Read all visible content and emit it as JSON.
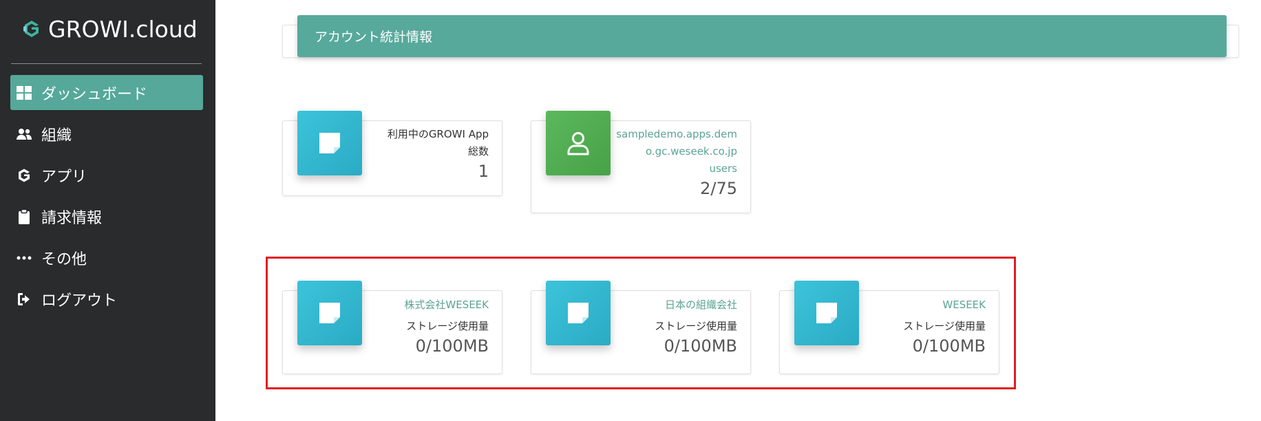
{
  "brand": {
    "name": "GROWI.cloud",
    "logo_icon": "growi-logo-icon"
  },
  "sidebar": {
    "items": [
      {
        "label": "ダッシュボード",
        "icon": "dashboard-grid-icon",
        "active": true
      },
      {
        "label": "組織",
        "icon": "users-icon",
        "active": false
      },
      {
        "label": "アプリ",
        "icon": "growi-app-icon",
        "active": false
      },
      {
        "label": "請求情報",
        "icon": "clipboard-icon",
        "active": false
      },
      {
        "label": "その他",
        "icon": "more-dots-icon",
        "active": false
      },
      {
        "label": "ログアウト",
        "icon": "sign-out-icon",
        "active": false
      }
    ]
  },
  "stats": {
    "title": "アカウント統計情報",
    "apps_card": {
      "label_line1": "利用中のGROWI App",
      "label_line2": "総数",
      "value": "1",
      "icon": "sticky-note-icon"
    },
    "users_card": {
      "label_line1": "sampledemo.apps.dem",
      "label_line2": "o.gc.weseek.co.jp",
      "label_line3": "users",
      "value": "2/75",
      "icon": "user-icon"
    },
    "storage_cards": [
      {
        "org": "株式会社WESEEK",
        "label": "ストレージ使用量",
        "value": "0/100MB",
        "icon": "sticky-note-icon"
      },
      {
        "org": "日本の組織会社",
        "label": "ストレージ使用量",
        "value": "0/100MB",
        "icon": "sticky-note-icon"
      },
      {
        "org": "WESEEK",
        "label": "ストレージ使用量",
        "value": "0/100MB",
        "icon": "sticky-note-icon"
      }
    ]
  },
  "colors": {
    "sidebar_bg": "#292b2c",
    "accent": "#56a89a",
    "teal_icon": "#33b8d0",
    "green_icon": "#52ad52",
    "highlight_border": "#e31b23"
  }
}
